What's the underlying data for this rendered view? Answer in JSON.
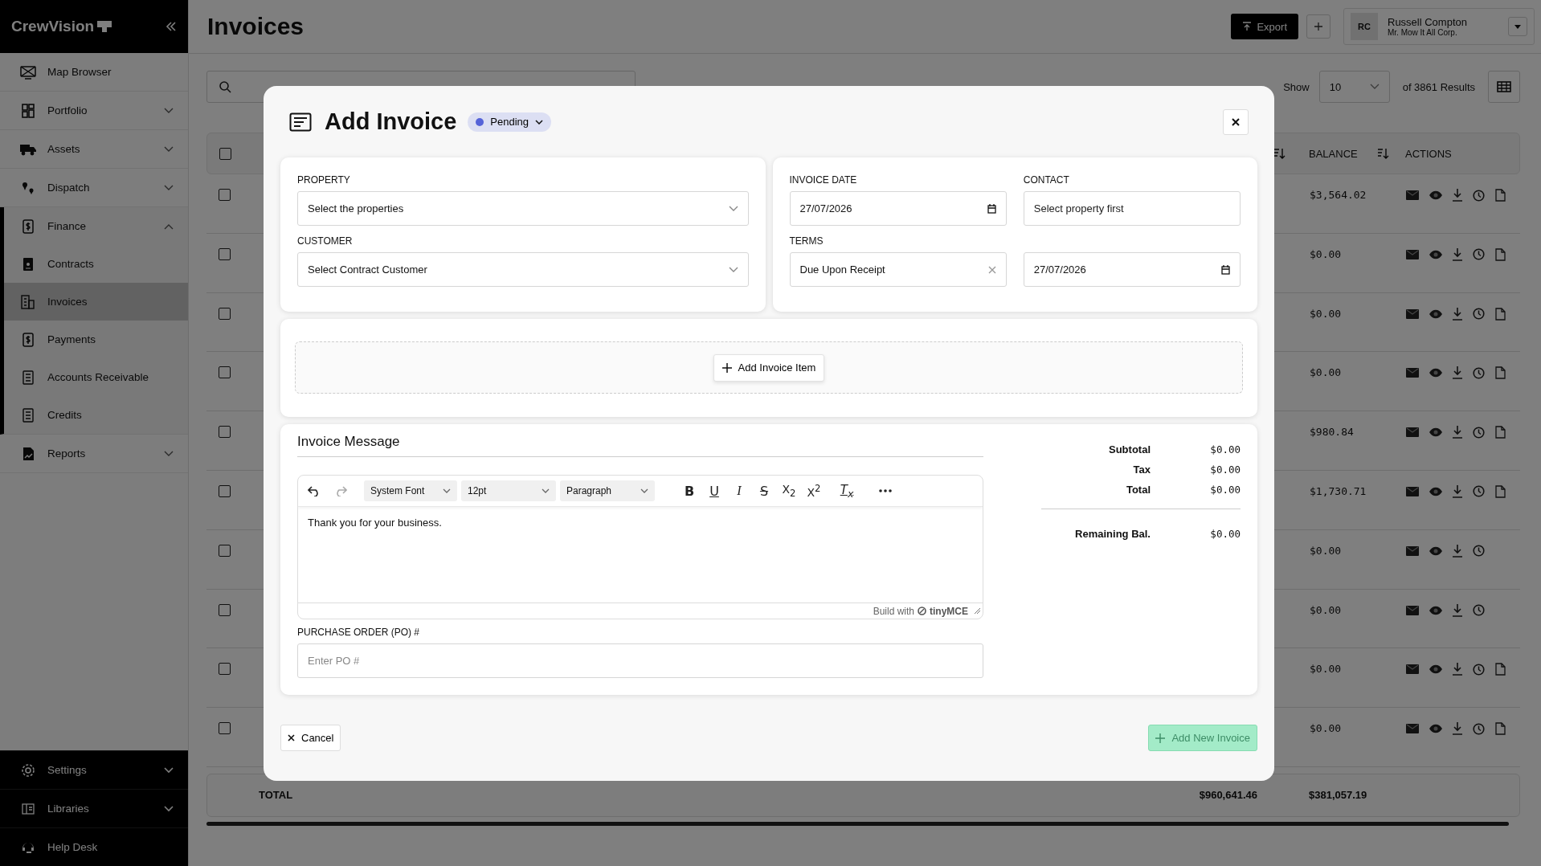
{
  "sidebar": {
    "logo": "CrewVision",
    "items": [
      {
        "label": "Map Browser",
        "selected": false
      },
      {
        "label": "Portfolio",
        "selected": false,
        "expanded": false
      },
      {
        "label": "Assets",
        "selected": false,
        "expanded": false
      },
      {
        "label": "Dispatch",
        "selected": false,
        "expanded": false
      },
      {
        "label": "Finance",
        "selected": false,
        "expanded": true,
        "children": [
          {
            "label": "Contracts",
            "selected": false
          },
          {
            "label": "Invoices",
            "selected": true
          },
          {
            "label": "Payments",
            "selected": false
          },
          {
            "label": "Accounts Receivable",
            "selected": false
          },
          {
            "label": "Credits",
            "selected": false
          }
        ]
      },
      {
        "label": "Reports",
        "selected": false,
        "expanded": false
      }
    ],
    "bottom_items": [
      {
        "label": "Settings",
        "expanded": false
      },
      {
        "label": "Libraries",
        "expanded": false
      },
      {
        "label": "Help Desk"
      }
    ]
  },
  "header": {
    "title": "Invoices",
    "export_button": "Export",
    "user": {
      "initials": "RC",
      "name": "Russell Compton",
      "company": "Mr. Mow It All Corp."
    }
  },
  "toolbar": {
    "show_label": "Show",
    "page_size": "10",
    "results": "of 3861 Results"
  },
  "table": {
    "all_checked": false,
    "columns": [
      "BALANCE",
      "ACTIONS"
    ],
    "rows": [
      {
        "checked": false,
        "balance": "$3,564.02",
        "document": true
      },
      {
        "checked": false,
        "balance": "$0.00",
        "document": true
      },
      {
        "checked": false,
        "balance": "$0.00",
        "document": true
      },
      {
        "checked": false,
        "balance": "$0.00",
        "document": true
      },
      {
        "checked": false,
        "balance": "$980.84",
        "document": true
      },
      {
        "checked": false,
        "balance": "$1,730.71",
        "document": true
      },
      {
        "checked": false,
        "balance": "$0.00",
        "document": false
      },
      {
        "checked": false,
        "balance": "$0.00",
        "document": false
      },
      {
        "checked": false,
        "balance": "$0.00",
        "document": true
      },
      {
        "checked": false,
        "balance": "$0.00",
        "document": true
      }
    ],
    "total": {
      "label": "TOTAL",
      "column_3": "$960,641.46",
      "balance": "$381,057.19"
    }
  },
  "modal": {
    "title": "Add Invoice",
    "status": "Pending",
    "left_fields": [
      {
        "label": "PROPERTY",
        "kind": "select",
        "placeholder": "Select the properties"
      },
      {
        "label": "CUSTOMER",
        "kind": "select",
        "placeholder": "Select Contract Customer"
      }
    ],
    "right_fields": [
      {
        "label": "INVOICE DATE",
        "kind": "date",
        "value": "27/07/2026"
      },
      {
        "label": "CONTACT",
        "kind": "text",
        "placeholder": "Select property first"
      },
      {
        "label": "TERMS",
        "kind": "clearable",
        "value": "Due Upon Receipt"
      },
      {
        "kind": "date",
        "value": "27/07/2026"
      }
    ],
    "add_item_button": "Add Invoice Item",
    "message": {
      "heading": "Invoice Message",
      "undo_disabled": false,
      "redo_disabled": true,
      "selects": [
        "System Font",
        "12pt",
        "Paragraph"
      ],
      "format_buttons": [
        {
          "kind": "bold",
          "label": "B"
        },
        {
          "kind": "underline",
          "label": "U"
        },
        {
          "kind": "italic",
          "label": "I"
        },
        {
          "kind": "strike",
          "label": "S"
        },
        {
          "kind": "subscript",
          "label": "X$_{2}$"
        },
        {
          "kind": "superscript",
          "label": "X$^{2}$"
        },
        {
          "kind": "clear",
          "label": "T$_{x}$"
        }
      ],
      "content": "Thank you for your business.",
      "footer_text": "Build with",
      "footer_brand": "tinyMCE"
    },
    "po": {
      "label": "PURCHASE ORDER (PO) #",
      "placeholder": "Enter PO #"
    },
    "totals": [
      {
        "label": "Subtotal",
        "value": "$0.00"
      },
      {
        "label": "Tax",
        "value": "$0.00"
      },
      {
        "label": "Total",
        "value": "$0.00"
      }
    ],
    "remaining": {
      "label": "Remaining Bal.",
      "value": "$0.00"
    },
    "cancel_button": "Cancel",
    "submit_button": {
      "label": "Add New Invoice",
      "disabled": true
    }
  }
}
